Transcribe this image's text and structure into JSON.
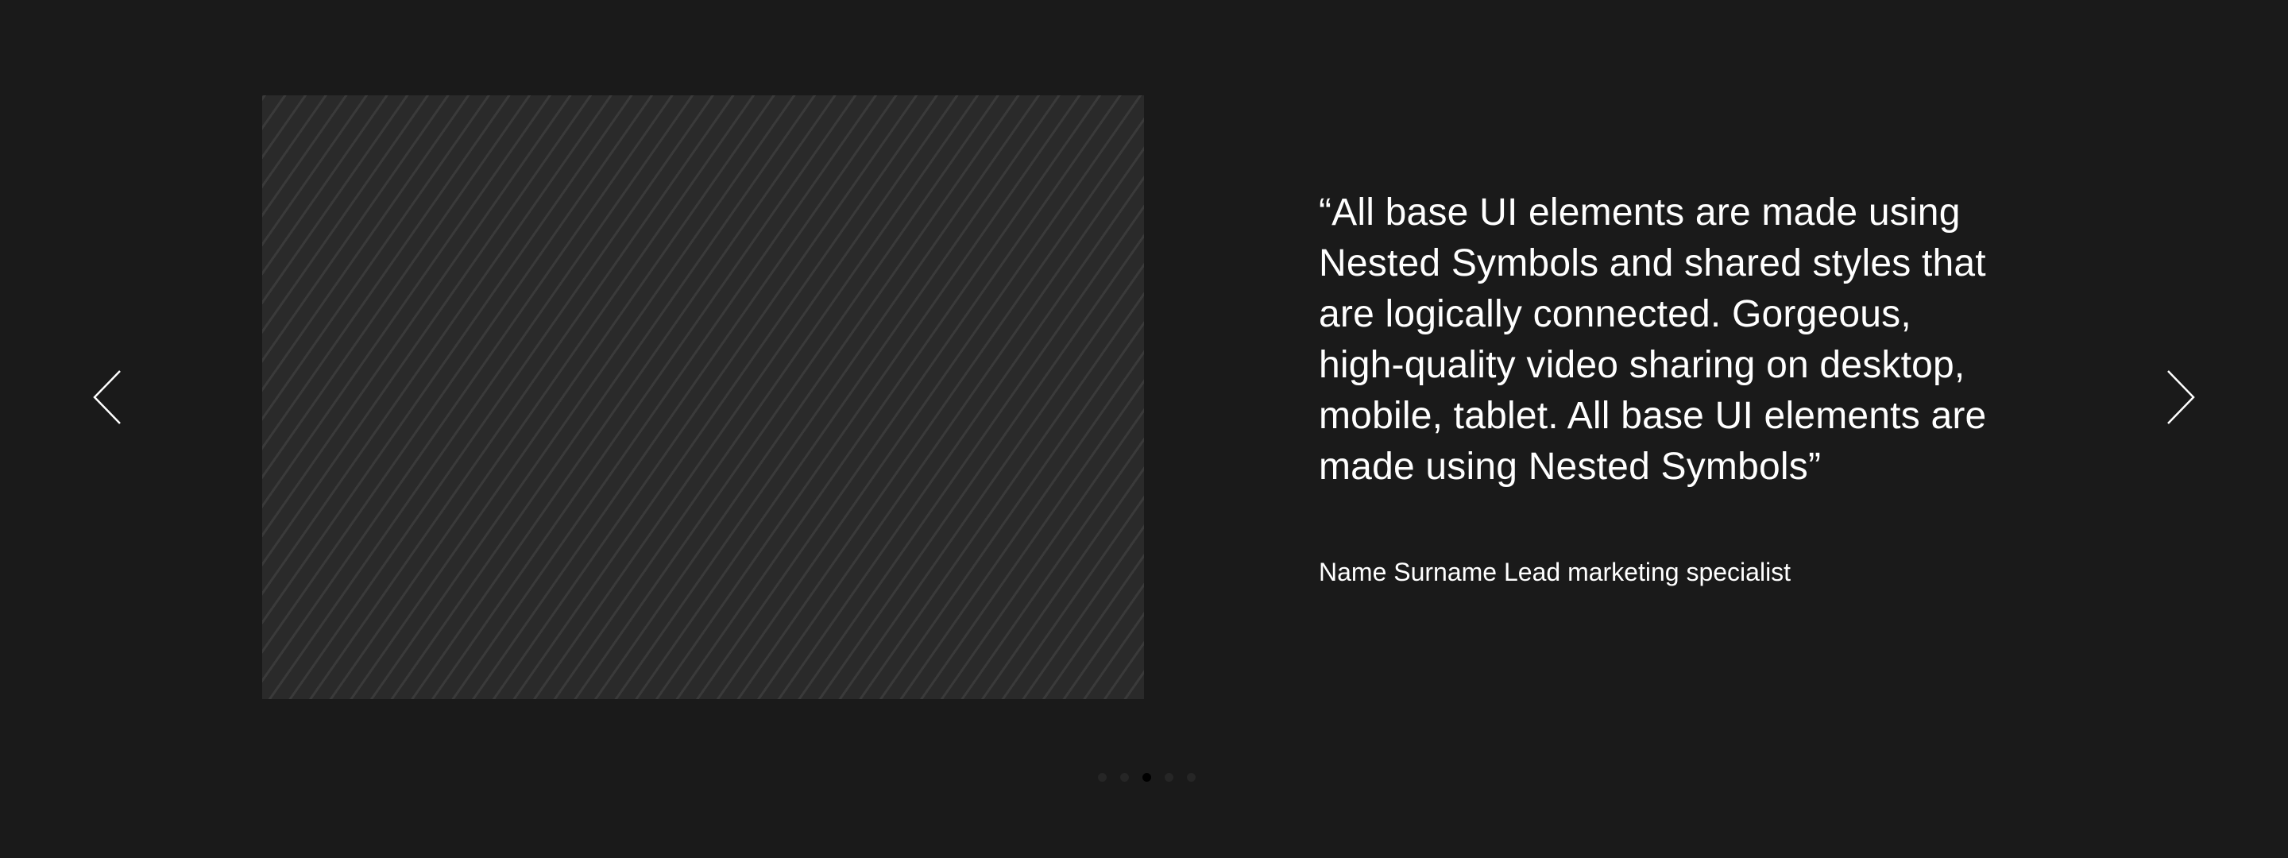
{
  "navigation": {
    "prev_icon": "chevron-left-icon",
    "next_icon": "chevron-right-icon",
    "arrow_color": "#ffffff"
  },
  "slide": {
    "image_icon": "image-placeholder",
    "quote": "“All base UI elements are made using\nNested Symbols and shared styles that\nare logically connected. Gorgeous,\nhigh-quality video sharing on desktop,\nmobile, tablet. All base UI elements are\nmade using Nested Symbols”",
    "author": "Name Surname Lead marketing specialist"
  },
  "pagination": {
    "total": 5,
    "active_index": 2
  },
  "colors": {
    "background": "#1a1a1a",
    "placeholder": "#2a2a2a",
    "text": "#ffffff"
  }
}
